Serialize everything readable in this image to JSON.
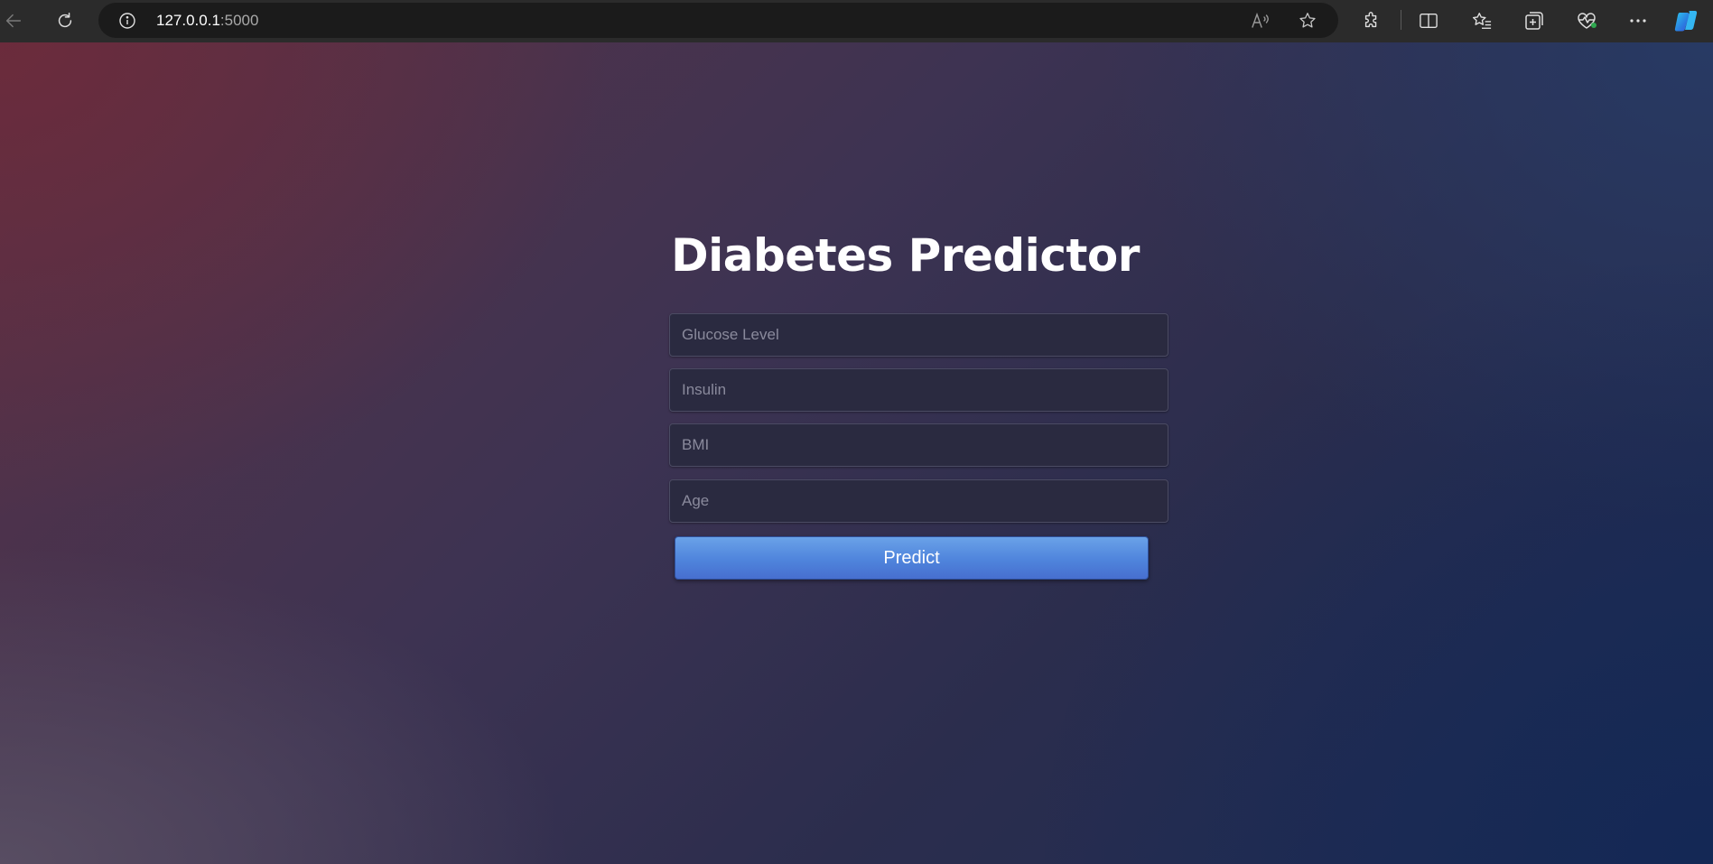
{
  "browser": {
    "url_host": "127.0.0.1",
    "url_port": ":5000",
    "icons": {
      "back": "back-arrow-icon",
      "refresh": "refresh-icon",
      "info": "info-icon",
      "read_aloud": "read-aloud-icon",
      "favorite": "star-icon",
      "extensions": "puzzle-icon",
      "split_screen": "split-screen-icon",
      "favorites": "favorites-list-icon",
      "collections": "collections-icon",
      "browser_essentials": "heartbeat-icon",
      "more": "more-icon",
      "copilot": "copilot-icon"
    }
  },
  "page": {
    "title": "Diabetes Predictor",
    "fields": [
      {
        "placeholder": "Glucose Level"
      },
      {
        "placeholder": "Insulin"
      },
      {
        "placeholder": "BMI"
      },
      {
        "placeholder": "Age"
      }
    ],
    "submit_label": "Predict"
  },
  "colors": {
    "button_accent": "#4f84dc",
    "page_gradient_start": "#5a3246",
    "page_gradient_end": "#1c2c55"
  }
}
